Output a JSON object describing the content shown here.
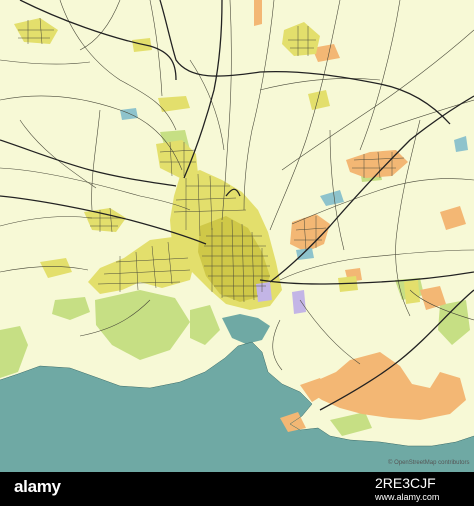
{
  "map": {
    "colors": {
      "land": "#f7f9d6",
      "sea": "#6fa9a4",
      "urban": "#e3df6c",
      "urban_dense": "#cfc848",
      "street": "#4a4a3a",
      "highway": "#222222",
      "park": "#c6df84",
      "industrial": "#f3b774",
      "water_inland": "#8ec3cc",
      "special": "#c3b5e6"
    },
    "attribution": "© OpenStreetMap contributors"
  },
  "footer": {
    "logo": "alamy",
    "stock_id": "2RE3CJF",
    "url": "www.alamy.com"
  }
}
